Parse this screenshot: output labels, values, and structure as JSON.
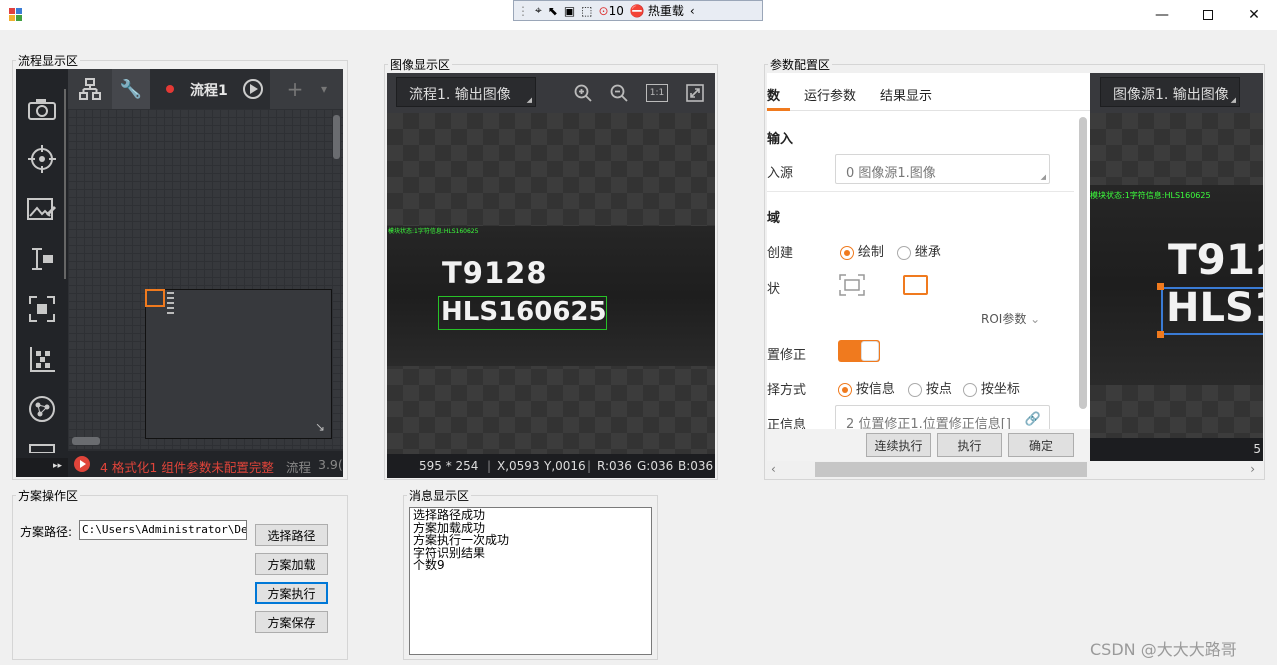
{
  "debug_toolbar": {
    "count": "10",
    "hot_reload": "热重载"
  },
  "flow_panel": {
    "legend": "流程显示区",
    "tab_title": "流程1",
    "status_text": "4 格式化1 组件参数未配置完整",
    "status_suffix": "流程",
    "status_num": "3.9("
  },
  "image_panel": {
    "legend": "图像显示区",
    "source_select": "流程1. 输出图像",
    "overlay_status": "模块状态:1字符信息:HLS160625",
    "ocr_line1": "T9128",
    "ocr_line2": "HLS160625",
    "status": {
      "size": "595 * 254",
      "x": "X,0593",
      "y": "Y,0016",
      "r": "R:036",
      "g": "G:036",
      "b": "B:036"
    }
  },
  "param_panel": {
    "legend": "参数配置区",
    "tabs": [
      "数",
      "运行参数",
      "结果显示"
    ],
    "section_input": "输入",
    "label_source": "入源",
    "source_value": "0 图像源1.图像",
    "section_region": "域",
    "label_create": "创建",
    "radio_draw": "绘制",
    "radio_inherit": "继承",
    "label_shape": "状",
    "roi_params": "ROI参数",
    "label_correct": "置修正",
    "label_mode": "择方式",
    "radio_info": "按信息",
    "radio_point": "按点",
    "radio_coord": "按坐标",
    "label_info": "正信息",
    "info_value": "2 位置修正1.位置修正信息[]",
    "btn_continuous": "连续执行",
    "btn_run": "执行",
    "btn_ok": "确定",
    "preview_select": "图像源1. 输出图像",
    "preview_status": "模块状态:1字符信息:HLS160625",
    "preview_text1": "T912",
    "preview_text2": "HLS1",
    "preview_corner": "5"
  },
  "solution_panel": {
    "legend": "方案操作区",
    "path_label": "方案路径:",
    "path_value": "C:\\Users\\Administrator\\Desk",
    "btn_select": "选择路径",
    "btn_load": "方案加载",
    "btn_execute": "方案执行",
    "btn_save": "方案保存"
  },
  "message_panel": {
    "legend": "消息显示区",
    "lines": [
      "选择路径成功",
      "方案加载成功",
      "方案执行一次成功",
      "字符识别结果",
      "个数9"
    ]
  },
  "watermark": "CSDN @大大大路哥",
  "colors": {
    "accent": "#f07a1e",
    "ocr_green": "#27c227",
    "status_red": "#e0443a",
    "dark_bg": "#2b2d31"
  }
}
